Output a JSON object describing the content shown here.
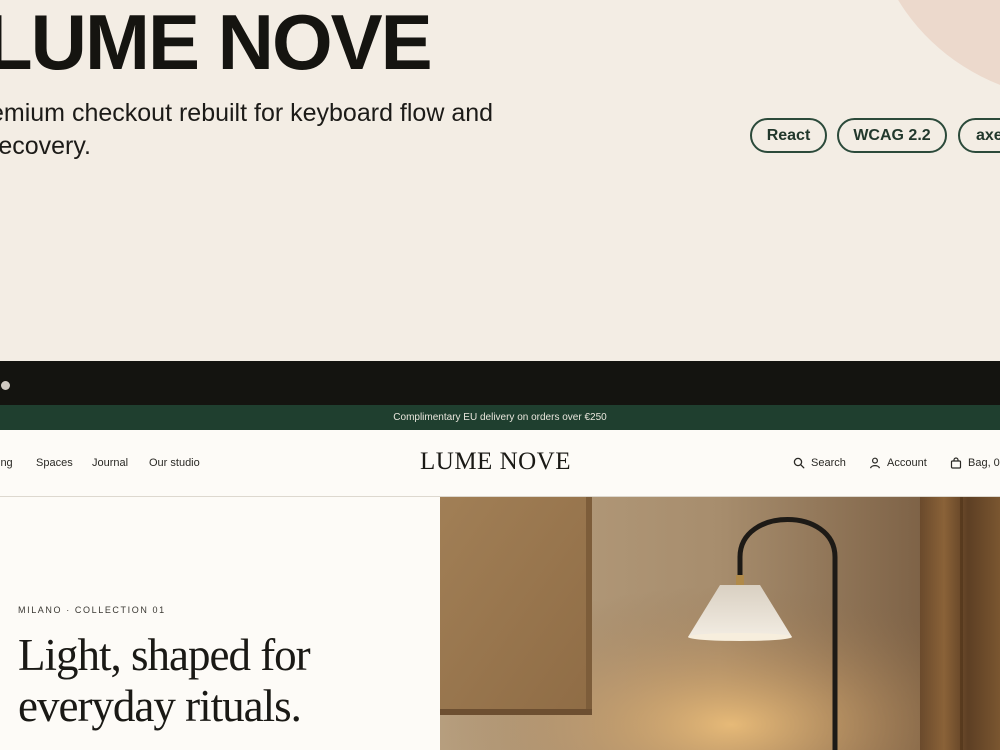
{
  "hero": {
    "title": "LUME NOVE",
    "description": "emium checkout rebuilt for keyboard flow and recovery.",
    "tags": [
      "React",
      "WCAG 2.2",
      "axe"
    ]
  },
  "announcement": "Complimentary EU delivery on orders over €250",
  "header": {
    "nav": [
      "ing",
      "Spaces",
      "Journal",
      "Our studio"
    ],
    "logo": "LUME NOVE",
    "search_label": "Search",
    "account_label": "Account",
    "bag_label": "Bag, 0"
  },
  "main": {
    "eyebrow": "MILANO · COLLECTION 01",
    "headline": "Light, shaped for everyday rituals."
  },
  "colors": {
    "page_background": "#f3ede4",
    "accent_green": "#1f3f2f",
    "browser_bar": "#141410",
    "ink": "#1a1915"
  }
}
